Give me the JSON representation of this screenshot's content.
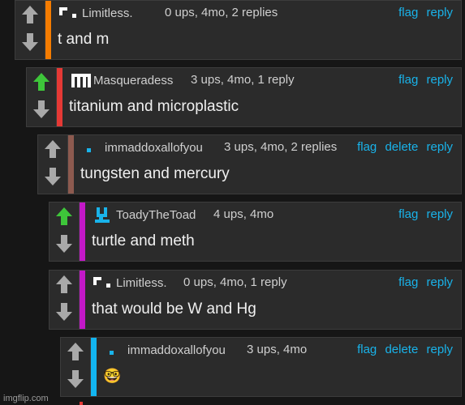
{
  "comments": [
    {
      "username": "Limitless.",
      "stats": "0 ups, 4mo, 2 replies",
      "text": "t and m",
      "actions": [
        "flag",
        "reply"
      ],
      "stripe_color": "#f57c00",
      "upvoted": false,
      "avatar_icon": "limitless-avatar-icon"
    },
    {
      "username": "Masqueradess",
      "stats": "3 ups, 4mo, 1 reply",
      "text": "titanium and microplastic",
      "actions": [
        "flag",
        "reply"
      ],
      "stripe_color": "#e53935",
      "upvoted": true,
      "avatar_icon": "masqueradess-avatar-icon"
    },
    {
      "username": "immaddoxallofyou",
      "stats": "3 ups, 4mo, 2 replies",
      "text": "tungsten and mercury",
      "actions": [
        "flag",
        "delete",
        "reply"
      ],
      "stripe_color": "#8d5a4f",
      "upvoted": false,
      "avatar_icon": "immaddox-avatar-icon"
    },
    {
      "username": "ToadyTheToad",
      "stats": "4 ups, 4mo",
      "text": "turtle and meth",
      "actions": [
        "flag",
        "reply"
      ],
      "stripe_color": "#c318c8",
      "upvoted": true,
      "avatar_icon": "toady-avatar-icon"
    },
    {
      "username": "Limitless.",
      "stats": "0 ups, 4mo, 1 reply",
      "text": "that would be W and Hg",
      "actions": [
        "flag",
        "reply"
      ],
      "stripe_color": "#c318c8",
      "upvoted": false,
      "avatar_icon": "limitless-avatar-icon"
    },
    {
      "username": "immaddoxallofyou",
      "stats": "3 ups, 4mo",
      "text": "🤓",
      "actions": [
        "flag",
        "delete",
        "reply"
      ],
      "stripe_color": "#12b5f0",
      "upvoted": false,
      "avatar_icon": "immaddox-avatar-icon"
    }
  ],
  "watermark": "imgflip.com",
  "colors": {
    "upvote_active": "#3ec63a",
    "vote_inactive": "#a9a9a9",
    "link": "#19b3ea"
  }
}
